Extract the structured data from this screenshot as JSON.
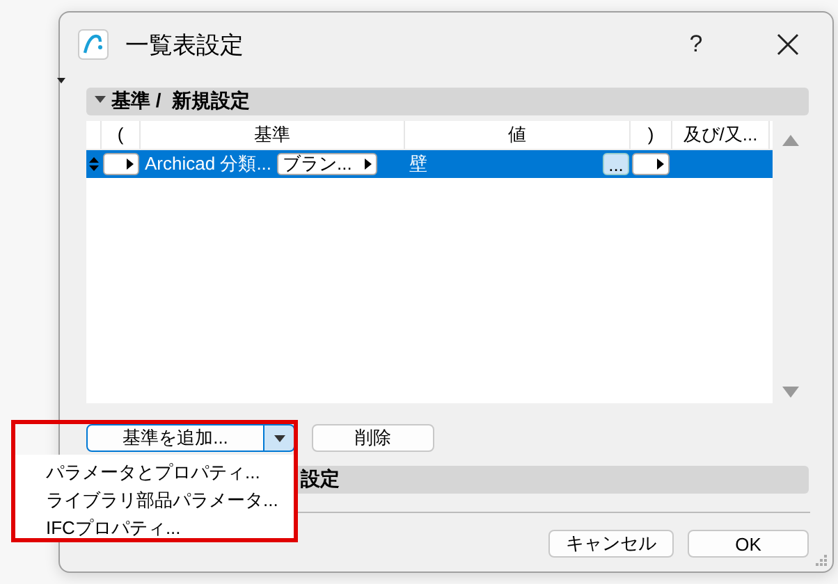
{
  "window": {
    "title": "一覧表設定",
    "help": "?"
  },
  "sections": [
    {
      "title": "基準 /  新規設定",
      "expanded": true
    },
    {
      "title": "設定"
    }
  ],
  "criteria_table": {
    "columns": [
      "(",
      "基準",
      "値",
      ")",
      "及び/又..."
    ],
    "rows": [
      {
        "selected": true,
        "criterion": "Archicad 分類...",
        "operator": "ブラン...",
        "value": "壁",
        "more": "..."
      }
    ]
  },
  "add_button": {
    "label": "基準を追加...",
    "menu_open": true
  },
  "delete_button": "削除",
  "add_menu": {
    "items": [
      "パラメータとプロパティ...",
      "ライブラリ部品パラメータ...",
      "IFCプロパティ..."
    ]
  },
  "footer_buttons": [
    "キャンセル",
    "OK"
  ]
}
